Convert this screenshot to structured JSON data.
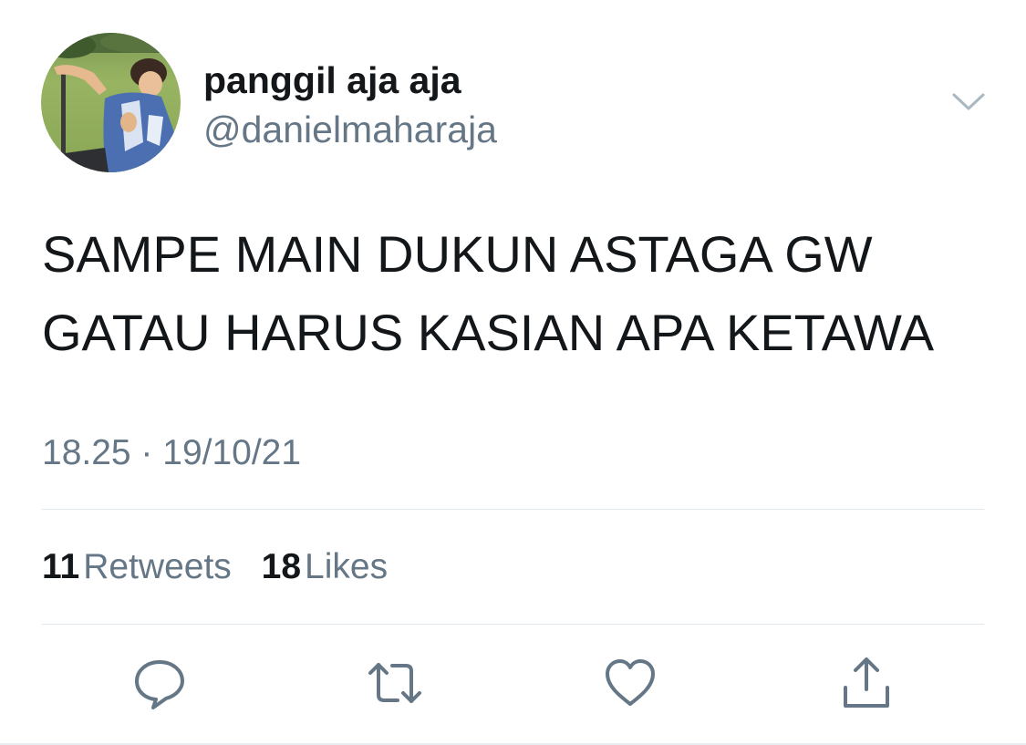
{
  "author": {
    "display_name": "panggil aja aja",
    "handle": "@danielmaharaja"
  },
  "tweet": {
    "text_lines": [
      "SAMPE MAIN DUKUN ASTAGA GW",
      "GATAU HARUS KASIAN APA KETAWA"
    ],
    "timestamp": "18.25 · 19/10/21"
  },
  "stats": {
    "retweets_count": "11",
    "retweets_label": "Retweets",
    "likes_count": "18",
    "likes_label": "Likes"
  },
  "icons": {
    "menu": "chevron-down-icon",
    "reply": "reply-icon",
    "retweet": "retweet-icon",
    "like": "heart-icon",
    "share": "share-icon"
  },
  "colors": {
    "text_primary": "#14171a",
    "text_secondary": "#657786",
    "icon_gray": "#657786",
    "divider": "#e1e8ed"
  }
}
